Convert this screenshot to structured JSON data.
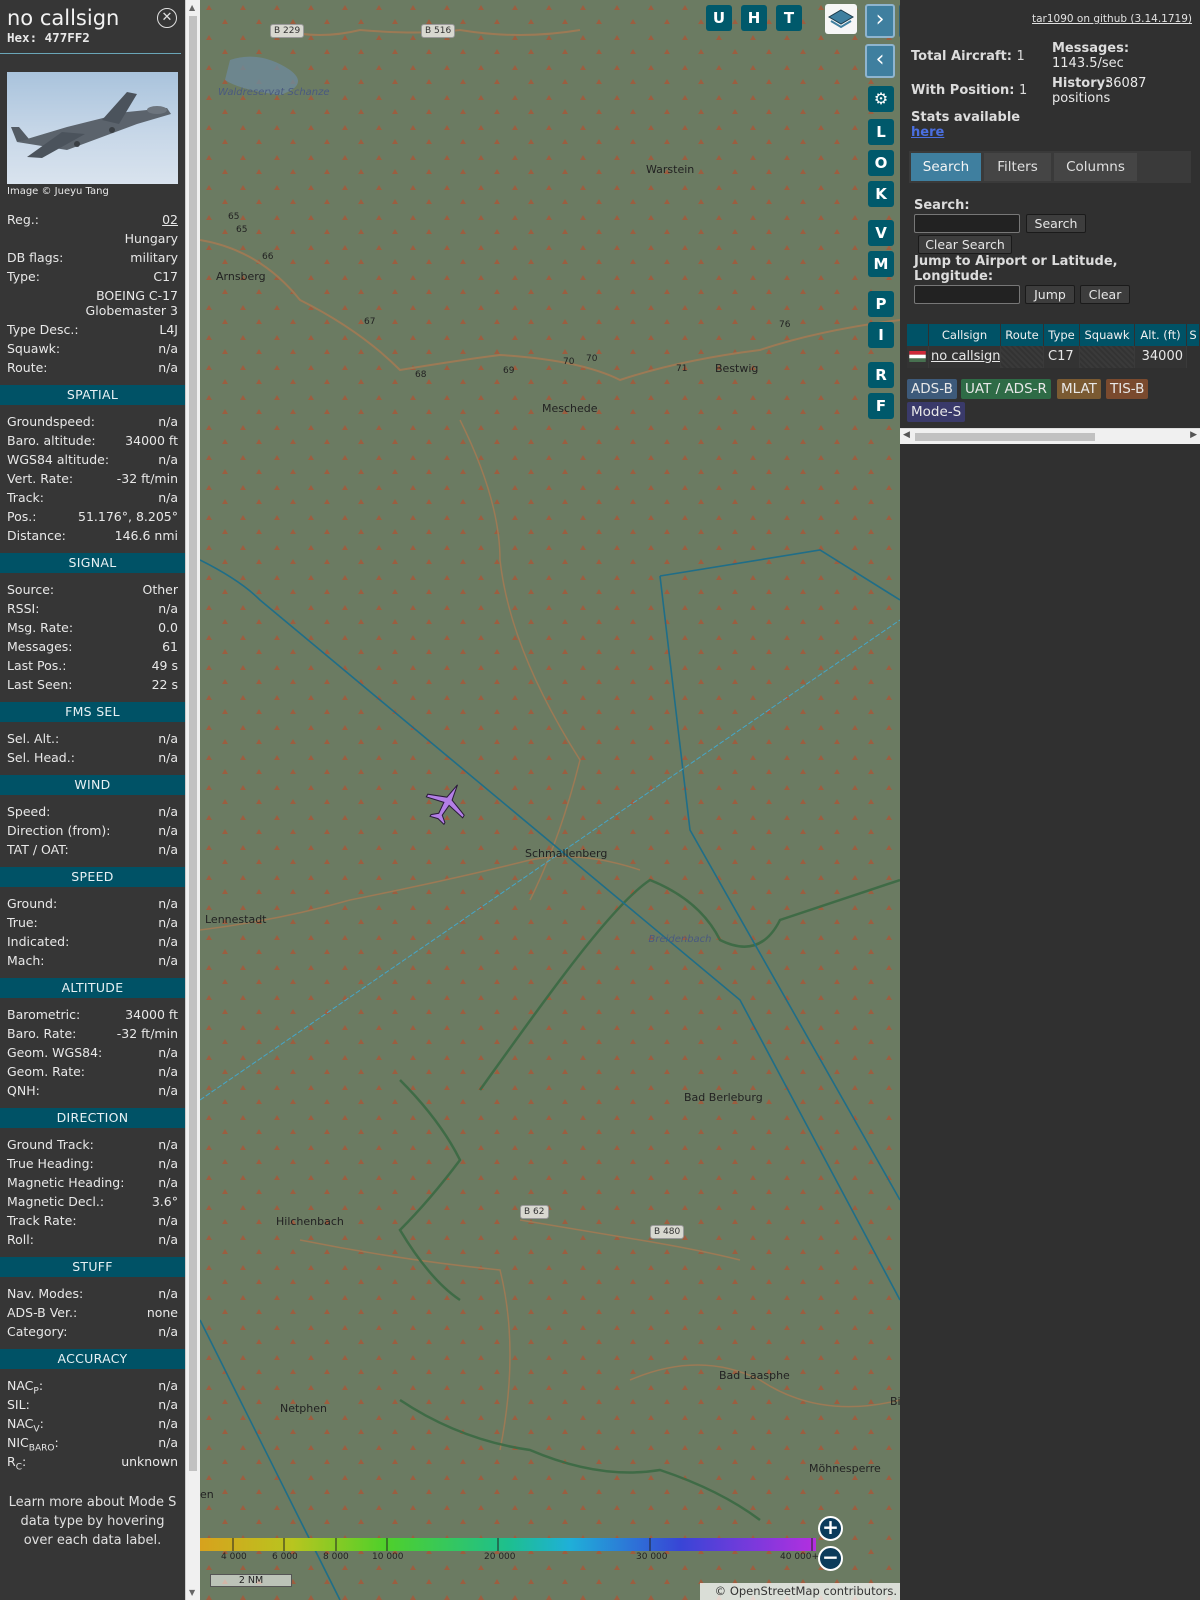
{
  "info": {
    "callsign": "no callsign",
    "hex_label": "Hex:",
    "hex_value": "477FF2",
    "photo_credit": "Image © Jueyu Tang",
    "rows_top": [
      {
        "k": "Reg.:",
        "v": "02"
      },
      {
        "k": "",
        "v": "Hungary"
      },
      {
        "k": "DB flags:",
        "v": "military"
      },
      {
        "k": "Type:",
        "v": "C17"
      },
      {
        "k": "",
        "v": "BOEING C-17 Globemaster 3"
      },
      {
        "k": "Type Desc.:",
        "v": "L4J"
      },
      {
        "k": "Squawk:",
        "v": "n/a"
      },
      {
        "k": "Route:",
        "v": "n/a"
      }
    ],
    "sections": [
      {
        "title": "SPATIAL",
        "rows": [
          {
            "k": "Groundspeed:",
            "v": "n/a"
          },
          {
            "k": "Baro. altitude:",
            "v": "34000 ft"
          },
          {
            "k": "WGS84 altitude:",
            "v": "n/a"
          },
          {
            "k": "Vert. Rate:",
            "v": "-32 ft/min"
          },
          {
            "k": "Track:",
            "v": "n/a"
          },
          {
            "k": "Pos.:",
            "v": "51.176°, 8.205°"
          },
          {
            "k": "Distance:",
            "v": "146.6 nmi"
          }
        ]
      },
      {
        "title": "SIGNAL",
        "rows": [
          {
            "k": "Source:",
            "v": "Other"
          },
          {
            "k": "RSSI:",
            "v": "n/a"
          },
          {
            "k": "Msg. Rate:",
            "v": "0.0"
          },
          {
            "k": "Messages:",
            "v": "61"
          },
          {
            "k": "Last Pos.:",
            "v": "49 s"
          },
          {
            "k": "Last Seen:",
            "v": "22 s"
          }
        ]
      },
      {
        "title": "FMS SEL",
        "rows": [
          {
            "k": "Sel. Alt.:",
            "v": "n/a"
          },
          {
            "k": "Sel. Head.:",
            "v": "n/a"
          }
        ]
      },
      {
        "title": "WIND",
        "rows": [
          {
            "k": "Speed:",
            "v": "n/a"
          },
          {
            "k": "Direction (from):",
            "v": "n/a"
          },
          {
            "k": "TAT / OAT:",
            "v": "n/a"
          }
        ]
      },
      {
        "title": "SPEED",
        "rows": [
          {
            "k": "Ground:",
            "v": "n/a"
          },
          {
            "k": "True:",
            "v": "n/a"
          },
          {
            "k": "Indicated:",
            "v": "n/a"
          },
          {
            "k": "Mach:",
            "v": "n/a"
          }
        ]
      },
      {
        "title": "ALTITUDE",
        "rows": [
          {
            "k": "Barometric:",
            "v": "34000 ft"
          },
          {
            "k": "Baro. Rate:",
            "v": "-32 ft/min"
          },
          {
            "k": "Geom. WGS84:",
            "v": "n/a"
          },
          {
            "k": "Geom. Rate:",
            "v": "n/a"
          },
          {
            "k": "QNH:",
            "v": "n/a"
          }
        ]
      },
      {
        "title": "DIRECTION",
        "rows": [
          {
            "k": "Ground Track:",
            "v": "n/a"
          },
          {
            "k": "True Heading:",
            "v": "n/a"
          },
          {
            "k": "Magnetic Heading:",
            "v": "n/a"
          },
          {
            "k": "Magnetic Decl.:",
            "v": "3.6°"
          },
          {
            "k": "Track Rate:",
            "v": "n/a"
          },
          {
            "k": "Roll:",
            "v": "n/a"
          }
        ]
      },
      {
        "title": "STUFF",
        "rows": [
          {
            "k": "Nav. Modes:",
            "v": "n/a"
          },
          {
            "k": "ADS-B Ver.:",
            "v": "none"
          },
          {
            "k": "Category:",
            "v": "n/a"
          }
        ]
      },
      {
        "title": "ACCURACY",
        "rows": [
          {
            "k": "NAC",
            "sub": "P",
            "v": "n/a"
          },
          {
            "k": "SIL:",
            "v": "n/a"
          },
          {
            "k": "NAC",
            "sub": "V",
            "v": "n/a"
          },
          {
            "k": "NIC",
            "sub": "BARO",
            "v": "n/a"
          },
          {
            "k": "R",
            "sub": "C",
            "v": "unknown"
          }
        ]
      }
    ],
    "footer": "Learn more about Mode S data type by hovering over each data label."
  },
  "map": {
    "places": [
      "Warstein",
      "Arnsberg",
      "Meschede",
      "Bestwig",
      "Schmallenberg",
      "Lennestadt",
      "Bad Berleburg",
      "Hilchenbach",
      "Bad Laasphe",
      "Netphen",
      "Breidenbach",
      "Waldreservat Schanze",
      "Möhnesperre",
      "en",
      "Bi"
    ],
    "roads": [
      "B 229",
      "B 516",
      "B 62",
      "B 480"
    ],
    "road_numbers": [
      "65",
      "65",
      "66",
      "67",
      "68",
      "69",
      "70",
      "70",
      "71",
      "76"
    ],
    "aircraft_label": "",
    "controls": [
      "U",
      "H",
      "T",
      "L",
      "O",
      "K",
      "V",
      "M",
      "P",
      "I",
      "R",
      "F"
    ],
    "colorbar_ticks": [
      "4 000",
      "6 000",
      "8 000",
      "10 000",
      "20 000",
      "30 000",
      "40 000+"
    ],
    "scale": "2 NM",
    "attribution": "© OpenStreetMap contributors.",
    "colors": {
      "map_bg": "#6b7b62",
      "aircraft": "#b37fe6",
      "range_ring": "#1f6e88",
      "track_line": "#45a6c8"
    }
  },
  "panel": {
    "github": "tar1090 on github (3.14.1719)",
    "total_aircraft_label": "Total Aircraft:",
    "total_aircraft": "1",
    "with_position_label": "With Position:",
    "with_position": "1",
    "messages_label": "Messages:",
    "messages_value": "1143.5/sec",
    "history_label": "History:",
    "history_value": "36087 positions",
    "stats_label": "Stats available",
    "stats_link": "here",
    "tabs": [
      "Search",
      "Filters",
      "Columns"
    ],
    "search_label": "Search:",
    "search_button": "Search",
    "clear_search_button": "Clear Search",
    "jump_label": "Jump to Airport or Latitude, Longitude:",
    "jump_button": "Jump",
    "clear_button": "Clear",
    "table_headers": [
      "",
      "Callsign",
      "Route",
      "Type",
      "Squawk",
      "Alt. (ft)",
      "S"
    ],
    "table_row": {
      "callsign": "no callsign",
      "route": "",
      "type": "C17",
      "squawk": "",
      "alt": "34000"
    },
    "legend": [
      {
        "label": "ADS-B",
        "color": "#3d5a7a"
      },
      {
        "label": "UAT / ADS-R",
        "color": "#2e6b46"
      },
      {
        "label": "MLAT",
        "color": "#7a5a32"
      },
      {
        "label": "TIS-B",
        "color": "#7a4a2e"
      },
      {
        "label": "Mode-S",
        "color": "#3a3a6a"
      }
    ]
  }
}
